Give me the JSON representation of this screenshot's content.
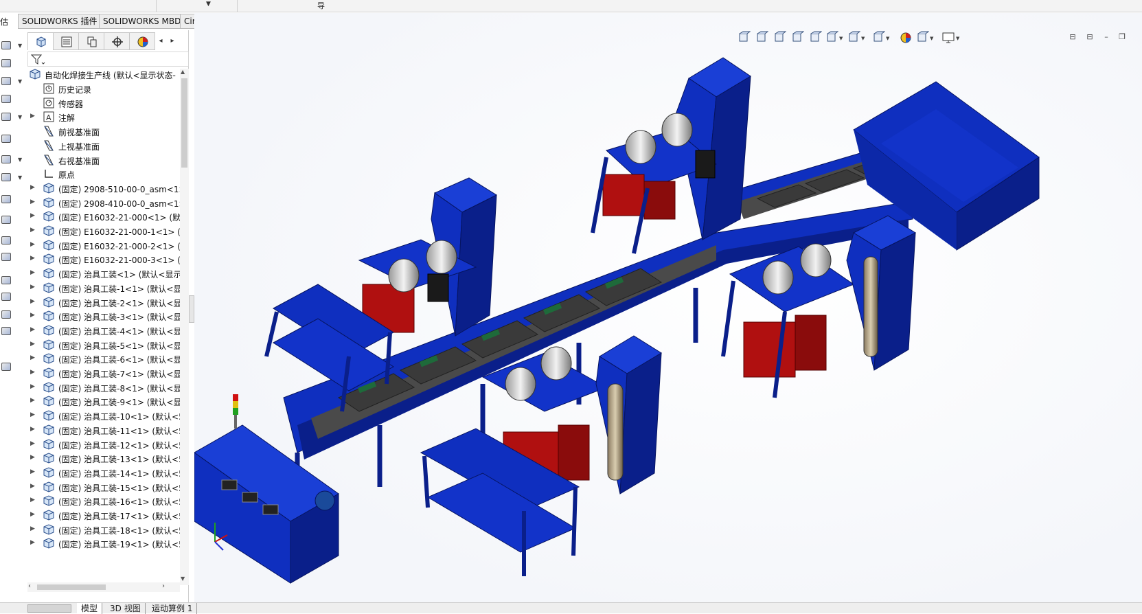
{
  "top_strip": {
    "glyph": "导"
  },
  "command_tabs": {
    "left_label": "估",
    "tabs": [
      "SOLIDWORKS 插件",
      "SOLIDWORKS MBD",
      "CircuitWorks"
    ]
  },
  "feature_tree": {
    "root": "自动化焊接生产线 (默认<显示状态-",
    "items": [
      {
        "label": "历史记录",
        "icon": "history-icon",
        "expand": false
      },
      {
        "label": "传感器",
        "icon": "sensor-icon",
        "expand": false
      },
      {
        "label": "注解",
        "icon": "annotation-icon",
        "expand": true
      },
      {
        "label": "前视基准面",
        "icon": "plane-icon",
        "expand": false
      },
      {
        "label": "上视基准面",
        "icon": "plane-icon",
        "expand": false
      },
      {
        "label": "右视基准面",
        "icon": "plane-icon",
        "expand": false
      },
      {
        "label": "原点",
        "icon": "origin-icon",
        "expand": false
      },
      {
        "label": "(固定) 2908-510-00-0_asm<1>",
        "icon": "assembly-icon",
        "expand": true
      },
      {
        "label": "(固定) 2908-410-00-0_asm<1>",
        "icon": "assembly-icon",
        "expand": true
      },
      {
        "label": "(固定) E16032-21-000<1> (默认",
        "icon": "assembly-icon",
        "expand": true
      },
      {
        "label": "(固定) E16032-21-000-1<1> (默",
        "icon": "assembly-icon",
        "expand": true
      },
      {
        "label": "(固定) E16032-21-000-2<1> (默",
        "icon": "assembly-icon",
        "expand": true
      },
      {
        "label": "(固定) E16032-21-000-3<1> (默",
        "icon": "assembly-icon",
        "expand": true
      },
      {
        "label": "(固定) 治具工装<1> (默认<显示",
        "icon": "assembly-icon",
        "expand": true
      },
      {
        "label": "(固定) 治具工装-1<1> (默认<显",
        "icon": "assembly-icon",
        "expand": true
      },
      {
        "label": "(固定) 治具工装-2<1> (默认<显",
        "icon": "assembly-icon",
        "expand": true
      },
      {
        "label": "(固定) 治具工装-3<1> (默认<显",
        "icon": "assembly-icon",
        "expand": true
      },
      {
        "label": "(固定) 治具工装-4<1> (默认<显",
        "icon": "assembly-icon",
        "expand": true
      },
      {
        "label": "(固定) 治具工装-5<1> (默认<显",
        "icon": "assembly-icon",
        "expand": true
      },
      {
        "label": "(固定) 治具工装-6<1> (默认<显",
        "icon": "assembly-icon",
        "expand": true
      },
      {
        "label": "(固定) 治具工装-7<1> (默认<显",
        "icon": "assembly-icon",
        "expand": true
      },
      {
        "label": "(固定) 治具工装-8<1> (默认<显",
        "icon": "assembly-icon",
        "expand": true
      },
      {
        "label": "(固定) 治具工装-9<1> (默认<显",
        "icon": "assembly-icon",
        "expand": true
      },
      {
        "label": "(固定) 治具工装-10<1> (默认<5",
        "icon": "assembly-icon",
        "expand": true
      },
      {
        "label": "(固定) 治具工装-11<1> (默认<5",
        "icon": "assembly-icon",
        "expand": true
      },
      {
        "label": "(固定) 治具工装-12<1> (默认<5",
        "icon": "assembly-icon",
        "expand": true
      },
      {
        "label": "(固定) 治具工装-13<1> (默认<5",
        "icon": "assembly-icon",
        "expand": true
      },
      {
        "label": "(固定) 治具工装-14<1> (默认<5",
        "icon": "assembly-icon",
        "expand": true
      },
      {
        "label": "(固定) 治具工装-15<1> (默认<5",
        "icon": "assembly-icon",
        "expand": true
      },
      {
        "label": "(固定) 治具工装-16<1> (默认<5",
        "icon": "assembly-icon",
        "expand": true
      },
      {
        "label": "(固定) 治具工装-17<1> (默认<5",
        "icon": "assembly-icon",
        "expand": true
      },
      {
        "label": "(固定) 治具工装-18<1> (默认<5",
        "icon": "assembly-icon",
        "expand": true
      },
      {
        "label": "(固定) 治具工装-19<1> (默认<5",
        "icon": "assembly-icon",
        "expand": true
      }
    ]
  },
  "bottom_tabs": [
    "模型",
    "3D 视图",
    "运动算例 1"
  ],
  "colors": {
    "machine_blue": "#0f2fbf",
    "machine_blue_dark": "#0a1f8a",
    "generator_red": "#b01010",
    "plate_gray": "#5a5a5a"
  }
}
